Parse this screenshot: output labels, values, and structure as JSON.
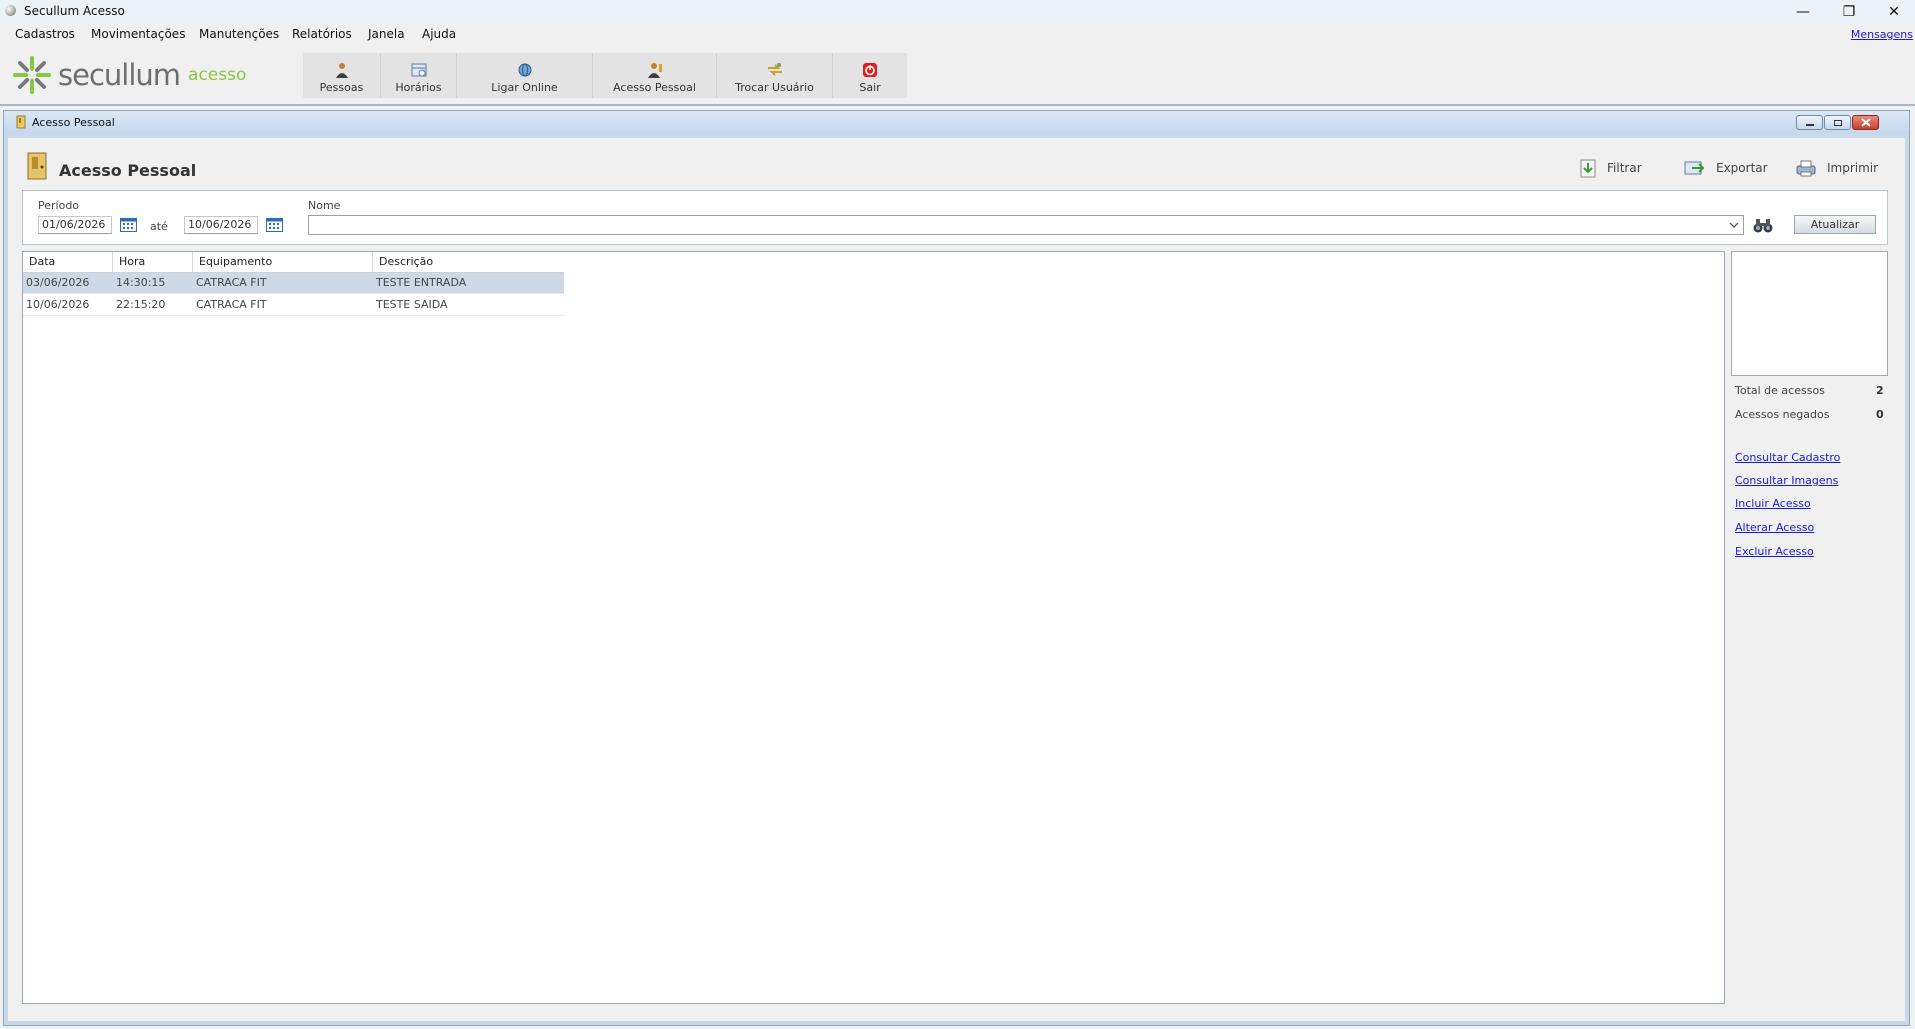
{
  "window": {
    "title": "Secullum Acesso",
    "minimize": "—",
    "restore": "❐",
    "close": "✕"
  },
  "menu": {
    "items": [
      "Cadastros",
      "Movimentações",
      "Manutenções",
      "Relatórios",
      "Janela",
      "Ajuda"
    ],
    "messages_link": "Mensagens"
  },
  "logo": {
    "word": "secullum",
    "sub": "acesso"
  },
  "toolbar": {
    "buttons": [
      "Pessoas",
      "Horários",
      "Ligar Online",
      "Acesso Pessoal",
      "Trocar Usuário",
      "Sair"
    ]
  },
  "child": {
    "title": "Acesso Pessoal",
    "page_title": "Acesso Pessoal",
    "actions": {
      "filter": "Filtrar",
      "export": "Exportar",
      "print": "Imprimir"
    }
  },
  "filter": {
    "period_label": "Período",
    "date_from": "01/06/2026",
    "until_label": "até",
    "date_to": "10/06/2026",
    "name_label": "Nome",
    "name_value": "",
    "refresh_button": "Atualizar"
  },
  "grid": {
    "columns": [
      "Data",
      "Hora",
      "Equipamento",
      "Descrição"
    ],
    "rows": [
      [
        "03/06/2026",
        "14:30:15",
        "CATRACA FIT",
        "TESTE ENTRADA"
      ],
      [
        "10/06/2026",
        "22:15:20",
        "CATRACA FIT",
        "TESTE SAIDA"
      ]
    ]
  },
  "stats": {
    "total_label": "Total de acessos",
    "total_value": "2",
    "denied_label": "Acessos negados",
    "denied_value": "0"
  },
  "links": [
    "Consultar Cadastro",
    "Consultar Imagens",
    "Incluir Acesso",
    "Alterar Acesso",
    "Excluir Acesso"
  ],
  "colors": {
    "accent_green": "#8cc63f",
    "link_blue": "#1a1ad8",
    "selected_row": "#cdd9e6",
    "exit_red": "#e02020"
  }
}
